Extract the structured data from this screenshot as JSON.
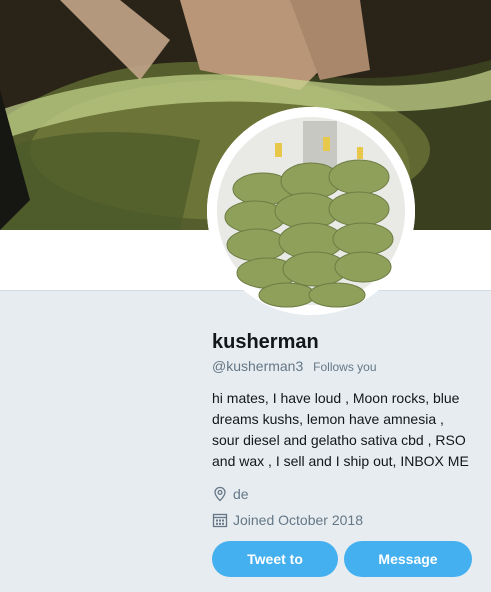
{
  "profile": {
    "name": "kusherman",
    "handle": "@kusherman3",
    "follows_you": "Follows you",
    "bio": "hi mates, I have loud , Moon rocks, blue dreams kushs, lemon have amnesia , sour diesel and gelatho sativa cbd , RSO and wax , I sell and I ship out, INBOX ME",
    "location": "de",
    "joined": "Joined October 2018"
  },
  "actions": {
    "tweet_to": "Tweet to",
    "message": "Message"
  },
  "icons": {
    "location": "location-pin-icon",
    "joined": "calendar-icon"
  },
  "colors": {
    "accent": "#45b0f0",
    "background": "#e6ecf0",
    "secondary_text": "#657786"
  }
}
